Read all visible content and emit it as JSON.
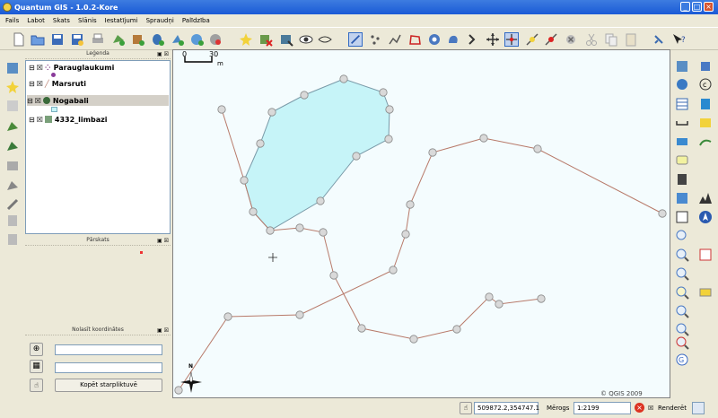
{
  "window": {
    "title": "Quantum GIS - 1.0.2-Kore"
  },
  "menu": [
    "Fails",
    "Labot",
    "Skats",
    "Slānis",
    "Iestatījumi",
    "Spraudņi",
    "Palīdzība"
  ],
  "legend": {
    "title": "Leģenda",
    "layers": [
      {
        "name": "Parauglaukumi",
        "checked": true,
        "selected": false
      },
      {
        "name": "Marsruti",
        "checked": true,
        "selected": false
      },
      {
        "name": "Nogabali",
        "checked": true,
        "selected": true
      },
      {
        "name": "4332_limbazi",
        "checked": true,
        "selected": false
      }
    ]
  },
  "overview": {
    "title": "Pārskats"
  },
  "coords_panel": {
    "title": "Nolasīt koordinātes",
    "field1": "",
    "field2": "",
    "copy_button": "Kopēt starpliktuvē"
  },
  "map": {
    "scalebar": {
      "left_label": "0",
      "right_label": "30",
      "unit": "m"
    },
    "north_label": "N",
    "copyright": "© QGIS 2009",
    "colors": {
      "polygon_fill": "#c6f4f8",
      "line": "#b87a6a",
      "vertex_fill": "#d9d9d9"
    }
  },
  "status": {
    "coordinates": "509872.2,354747.1",
    "scale_label": "Mērogs",
    "scale_value": "1:2199",
    "render_label": "Renderēt",
    "render_checked": true
  }
}
